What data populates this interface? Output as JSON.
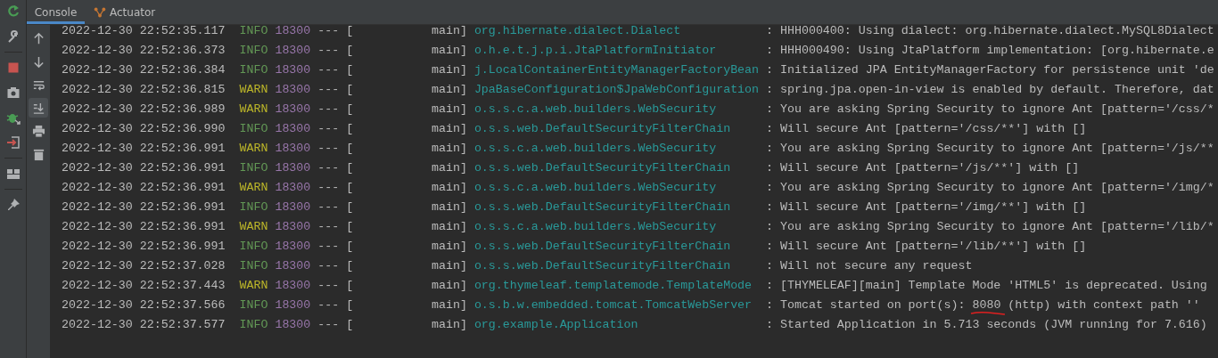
{
  "tabs": [
    {
      "label": "Console",
      "selected": true
    },
    {
      "label": "Actuator",
      "selected": false
    }
  ],
  "console_toolbar": [
    {
      "selected": false
    },
    {
      "selected": false
    },
    {
      "selected": false
    },
    {
      "selected": true
    },
    {
      "selected": false
    },
    {
      "selected": false
    }
  ],
  "log_lines": [
    {
      "timestamp": "2022-12-30 22:52:35.117",
      "level": "INFO",
      "kind": "info",
      "pid": "18300",
      "separator": "---",
      "thread": "[           main]",
      "logger": "org.hibernate.dialect.Dialect",
      "message": ": HHH000400: Using dialect: org.hibernate.dialect.MySQL8Dialect"
    },
    {
      "timestamp": "2022-12-30 22:52:36.373",
      "level": "INFO",
      "kind": "info",
      "pid": "18300",
      "separator": "---",
      "thread": "[           main]",
      "logger": "o.h.e.t.j.p.i.JtaPlatformInitiator",
      "message": ": HHH000490: Using JtaPlatform implementation: [org.hibernate.e"
    },
    {
      "timestamp": "2022-12-30 22:52:36.384",
      "level": "INFO",
      "kind": "info",
      "pid": "18300",
      "separator": "---",
      "thread": "[           main]",
      "logger": "j.LocalContainerEntityManagerFactoryBean",
      "message": ": Initialized JPA EntityManagerFactory for persistence unit 'de"
    },
    {
      "timestamp": "2022-12-30 22:52:36.815",
      "level": "WARN",
      "kind": "warn",
      "pid": "18300",
      "separator": "---",
      "thread": "[           main]",
      "logger": "JpaBaseConfiguration$JpaWebConfiguration",
      "message": ": spring.jpa.open-in-view is enabled by default. Therefore, dat"
    },
    {
      "timestamp": "2022-12-30 22:52:36.989",
      "level": "WARN",
      "kind": "warn",
      "pid": "18300",
      "separator": "---",
      "thread": "[           main]",
      "logger": "o.s.s.c.a.web.builders.WebSecurity",
      "message": ": You are asking Spring Security to ignore Ant [pattern='/css/*"
    },
    {
      "timestamp": "2022-12-30 22:52:36.990",
      "level": "INFO",
      "kind": "info",
      "pid": "18300",
      "separator": "---",
      "thread": "[           main]",
      "logger": "o.s.s.web.DefaultSecurityFilterChain",
      "message": ": Will secure Ant [pattern='/css/**'] with []"
    },
    {
      "timestamp": "2022-12-30 22:52:36.991",
      "level": "WARN",
      "kind": "warn",
      "pid": "18300",
      "separator": "---",
      "thread": "[           main]",
      "logger": "o.s.s.c.a.web.builders.WebSecurity",
      "message": ": You are asking Spring Security to ignore Ant [pattern='/js/**"
    },
    {
      "timestamp": "2022-12-30 22:52:36.991",
      "level": "INFO",
      "kind": "info",
      "pid": "18300",
      "separator": "---",
      "thread": "[           main]",
      "logger": "o.s.s.web.DefaultSecurityFilterChain",
      "message": ": Will secure Ant [pattern='/js/**'] with []"
    },
    {
      "timestamp": "2022-12-30 22:52:36.991",
      "level": "WARN",
      "kind": "warn",
      "pid": "18300",
      "separator": "---",
      "thread": "[           main]",
      "logger": "o.s.s.c.a.web.builders.WebSecurity",
      "message": ": You are asking Spring Security to ignore Ant [pattern='/img/*"
    },
    {
      "timestamp": "2022-12-30 22:52:36.991",
      "level": "INFO",
      "kind": "info",
      "pid": "18300",
      "separator": "---",
      "thread": "[           main]",
      "logger": "o.s.s.web.DefaultSecurityFilterChain",
      "message": ": Will secure Ant [pattern='/img/**'] with []"
    },
    {
      "timestamp": "2022-12-30 22:52:36.991",
      "level": "WARN",
      "kind": "warn",
      "pid": "18300",
      "separator": "---",
      "thread": "[           main]",
      "logger": "o.s.s.c.a.web.builders.WebSecurity",
      "message": ": You are asking Spring Security to ignore Ant [pattern='/lib/*"
    },
    {
      "timestamp": "2022-12-30 22:52:36.991",
      "level": "INFO",
      "kind": "info",
      "pid": "18300",
      "separator": "---",
      "thread": "[           main]",
      "logger": "o.s.s.web.DefaultSecurityFilterChain",
      "message": ": Will secure Ant [pattern='/lib/**'] with []"
    },
    {
      "timestamp": "2022-12-30 22:52:37.028",
      "level": "INFO",
      "kind": "info",
      "pid": "18300",
      "separator": "---",
      "thread": "[           main]",
      "logger": "o.s.s.web.DefaultSecurityFilterChain",
      "message": ": Will not secure any request"
    },
    {
      "timestamp": "2022-12-30 22:52:37.443",
      "level": "WARN",
      "kind": "warn",
      "pid": "18300",
      "separator": "---",
      "thread": "[           main]",
      "logger": "org.thymeleaf.templatemode.TemplateMode",
      "message": ": [THYMELEAF][main] Template Mode 'HTML5' is deprecated. Using"
    },
    {
      "timestamp": "2022-12-30 22:52:37.566",
      "level": "INFO",
      "kind": "info",
      "pid": "18300",
      "separator": "---",
      "thread": "[           main]",
      "logger": "o.s.b.w.embedded.tomcat.TomcatWebServer",
      "message_parts": [
        {
          "text": ": Tomcat started on port(s): ",
          "underlined": false
        },
        {
          "text": "8080",
          "underlined": true
        },
        {
          "text": " (http) with context path ''",
          "underlined": false
        }
      ]
    },
    {
      "timestamp": "2022-12-30 22:52:37.577",
      "level": "INFO",
      "kind": "info",
      "pid": "18300",
      "separator": "---",
      "thread": "[           main]",
      "logger": "org.example.Application",
      "message": ": Started Application in 5.713 seconds (JVM running for 7.616)"
    }
  ]
}
